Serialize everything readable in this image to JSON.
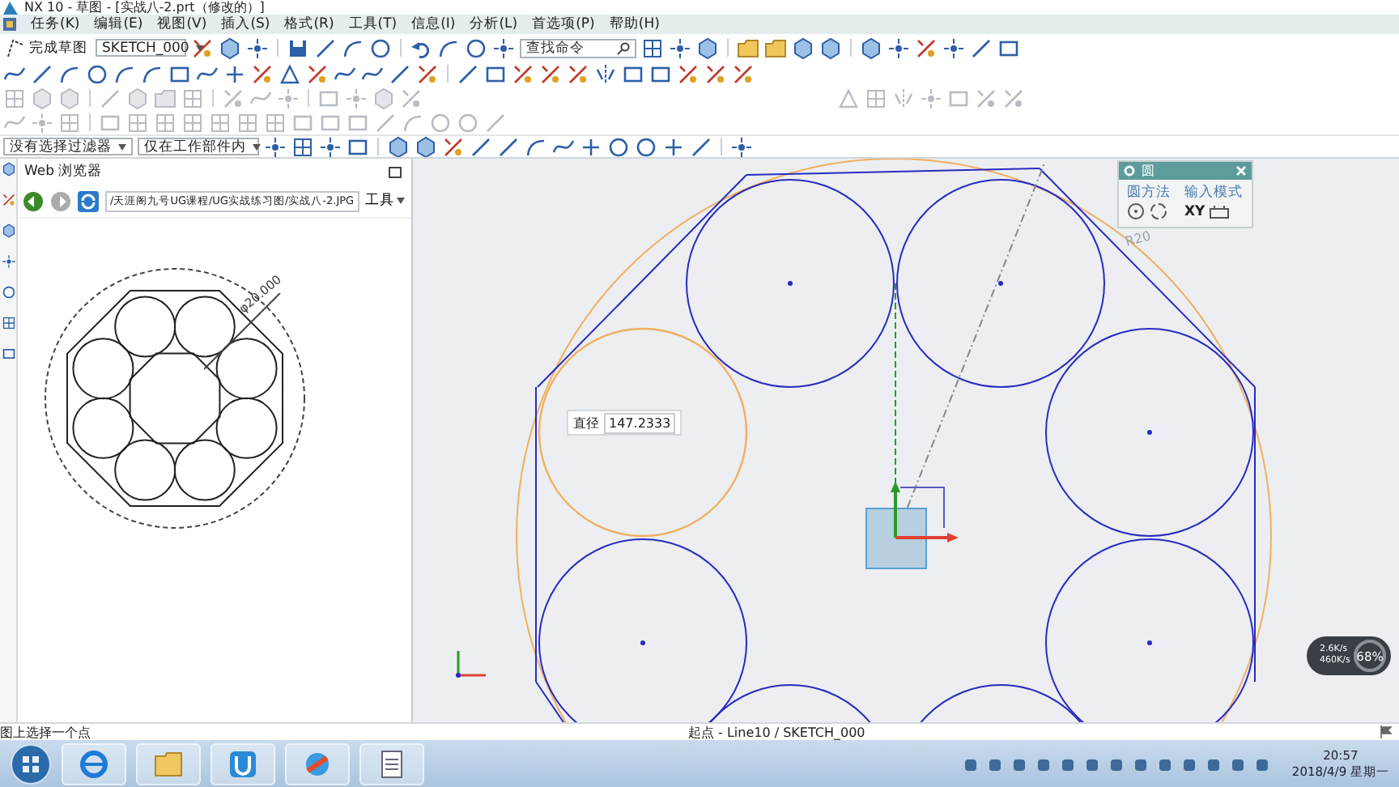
{
  "window": {
    "title": "NX 10 - 草图 - [实战八-2.prt（修改的）]"
  },
  "menu": [
    "任务(K)",
    "编辑(E)",
    "视图(V)",
    "插入(S)",
    "格式(R)",
    "工具(T)",
    "信息(I)",
    "分析(L)",
    "首选项(P)",
    "帮助(H)"
  ],
  "toolbar": {
    "finish_sketch": "完成草图",
    "sketch_name": "SKETCH_000",
    "search_placeholder": "查找命令"
  },
  "filter_bar": {
    "selection_filter": "没有选择过滤器",
    "scope": "仅在工作部件内"
  },
  "browser": {
    "title": "Web 浏览器",
    "address": "/天涯阁九号UG课程/UG实战练习图/实战八-2.JPG",
    "tools_menu": "工具",
    "image_dimension": "φ20.000"
  },
  "circle_dialog": {
    "title": "圆",
    "circle_method_label": "圆方法",
    "input_mode_label": "输入模式",
    "input_mode_xy": "XY"
  },
  "canvas": {
    "diameter_label": "直径",
    "diameter_value": "147.2333",
    "radius_label": "R20"
  },
  "net_monitor": {
    "upload": "2.6K/s",
    "download": "460K/s",
    "percent": "68%"
  },
  "status_bar": {
    "prompt": "图上选择一个点",
    "selection": "起点 - Line10 / SKETCH_000"
  },
  "taskbar": {
    "time": "20:57",
    "date": "2018/4/9 星期一"
  }
}
